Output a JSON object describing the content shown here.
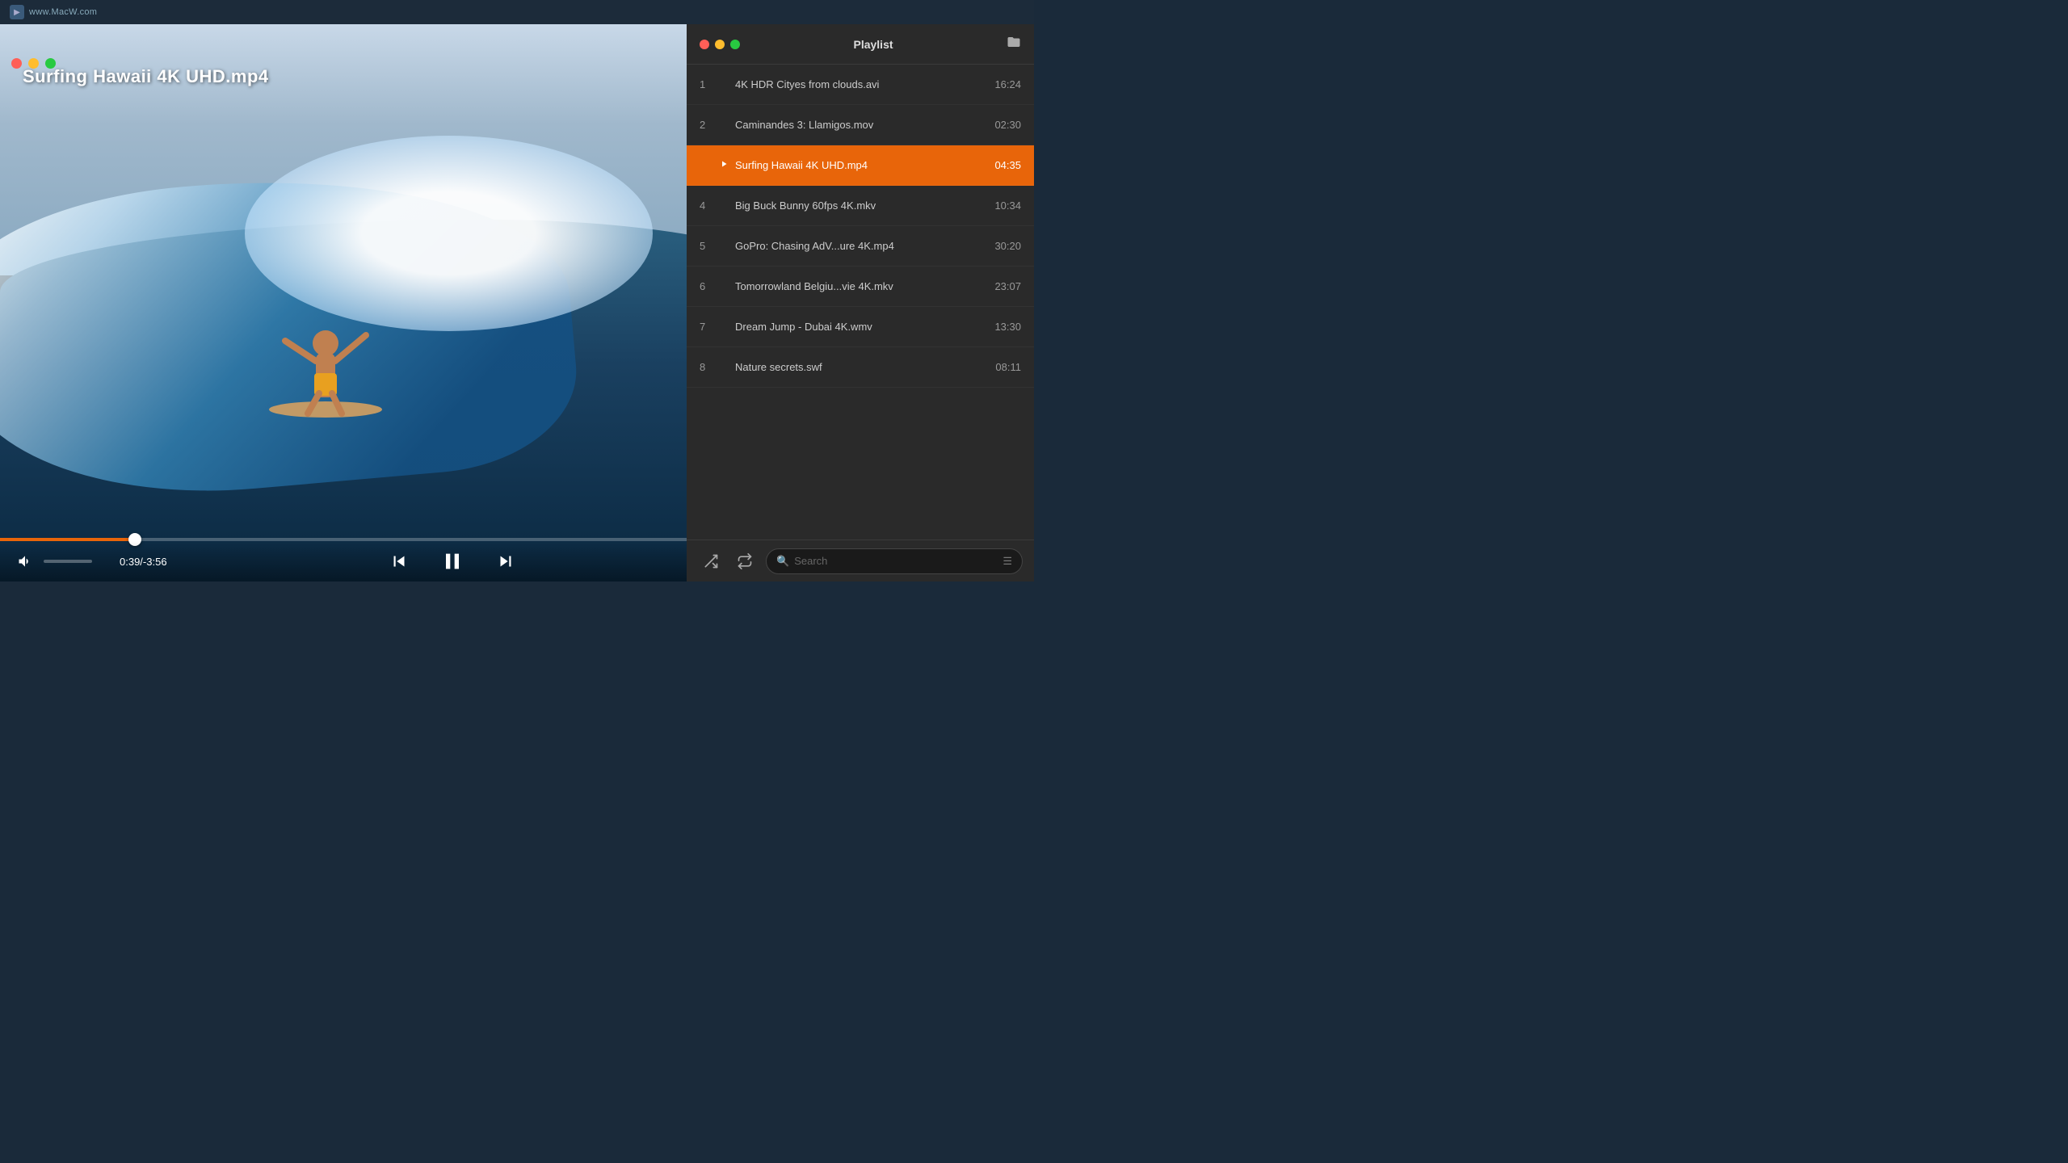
{
  "topbar": {
    "logo_alt": "MacW logo",
    "url": "www.MacW.com"
  },
  "video": {
    "title": "Surfing Hawaii 4K UHD.mp4",
    "time_current": "0:39",
    "time_total": "-3:56",
    "time_display": "0:39/-3:56",
    "progress_percent": 16.5
  },
  "playlist": {
    "title": "Playlist",
    "items": [
      {
        "num": "1",
        "name": "4K HDR Cityes from clouds.avi",
        "duration": "16:24",
        "active": false
      },
      {
        "num": "2",
        "name": "Caminandes 3: Llamigos.mov",
        "duration": "02:30",
        "active": false
      },
      {
        "num": "3",
        "name": "Surfing Hawaii 4K UHD.mp4",
        "duration": "04:35",
        "active": true
      },
      {
        "num": "4",
        "name": "Big Buck Bunny 60fps 4K.mkv",
        "duration": "10:34",
        "active": false
      },
      {
        "num": "5",
        "name": "GoPro: Chasing AdV...ure 4K.mp4",
        "duration": "30:20",
        "active": false
      },
      {
        "num": "6",
        "name": "Tomorrowland Belgiu...vie 4K.mkv",
        "duration": "23:07",
        "active": false
      },
      {
        "num": "7",
        "name": "Dream Jump - Dubai 4K.wmv",
        "duration": "13:30",
        "active": false
      },
      {
        "num": "8",
        "name": "Nature secrets.swf",
        "duration": "08:11",
        "active": false
      }
    ],
    "search_placeholder": "Search"
  },
  "buttons": {
    "shuffle": "shuffle",
    "repeat": "repeat",
    "menu": "menu",
    "link": "link",
    "volume": "volume",
    "prev": "previous",
    "play_pause": "pause",
    "next": "next",
    "airplay": "airplay",
    "settings": "settings",
    "folder": "folder"
  }
}
